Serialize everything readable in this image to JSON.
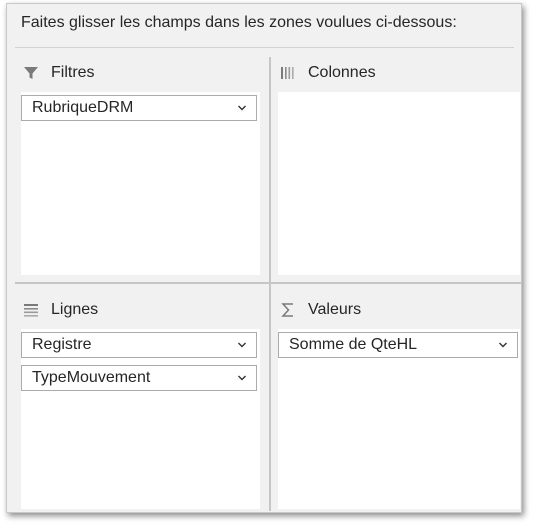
{
  "instruction": "Faites glisser les champs dans les zones voulues ci-dessous:",
  "areas": {
    "filters": {
      "label": "Filtres",
      "icon": "filter-icon",
      "fields": [
        "RubriqueDRM"
      ]
    },
    "columns": {
      "label": "Colonnes",
      "icon": "columns-icon",
      "fields": []
    },
    "rows": {
      "label": "Lignes",
      "icon": "rows-icon",
      "fields": [
        "Registre",
        "TypeMouvement"
      ]
    },
    "values": {
      "label": "Valeurs",
      "icon": "sigma-icon",
      "fields": [
        "Somme de QteHL"
      ]
    }
  },
  "colors": {
    "panel_background": "#f1f1f1",
    "zone_background": "#ffffff",
    "field_border": "#ababab",
    "text": "#262626",
    "icon": "#7a7a7a"
  }
}
